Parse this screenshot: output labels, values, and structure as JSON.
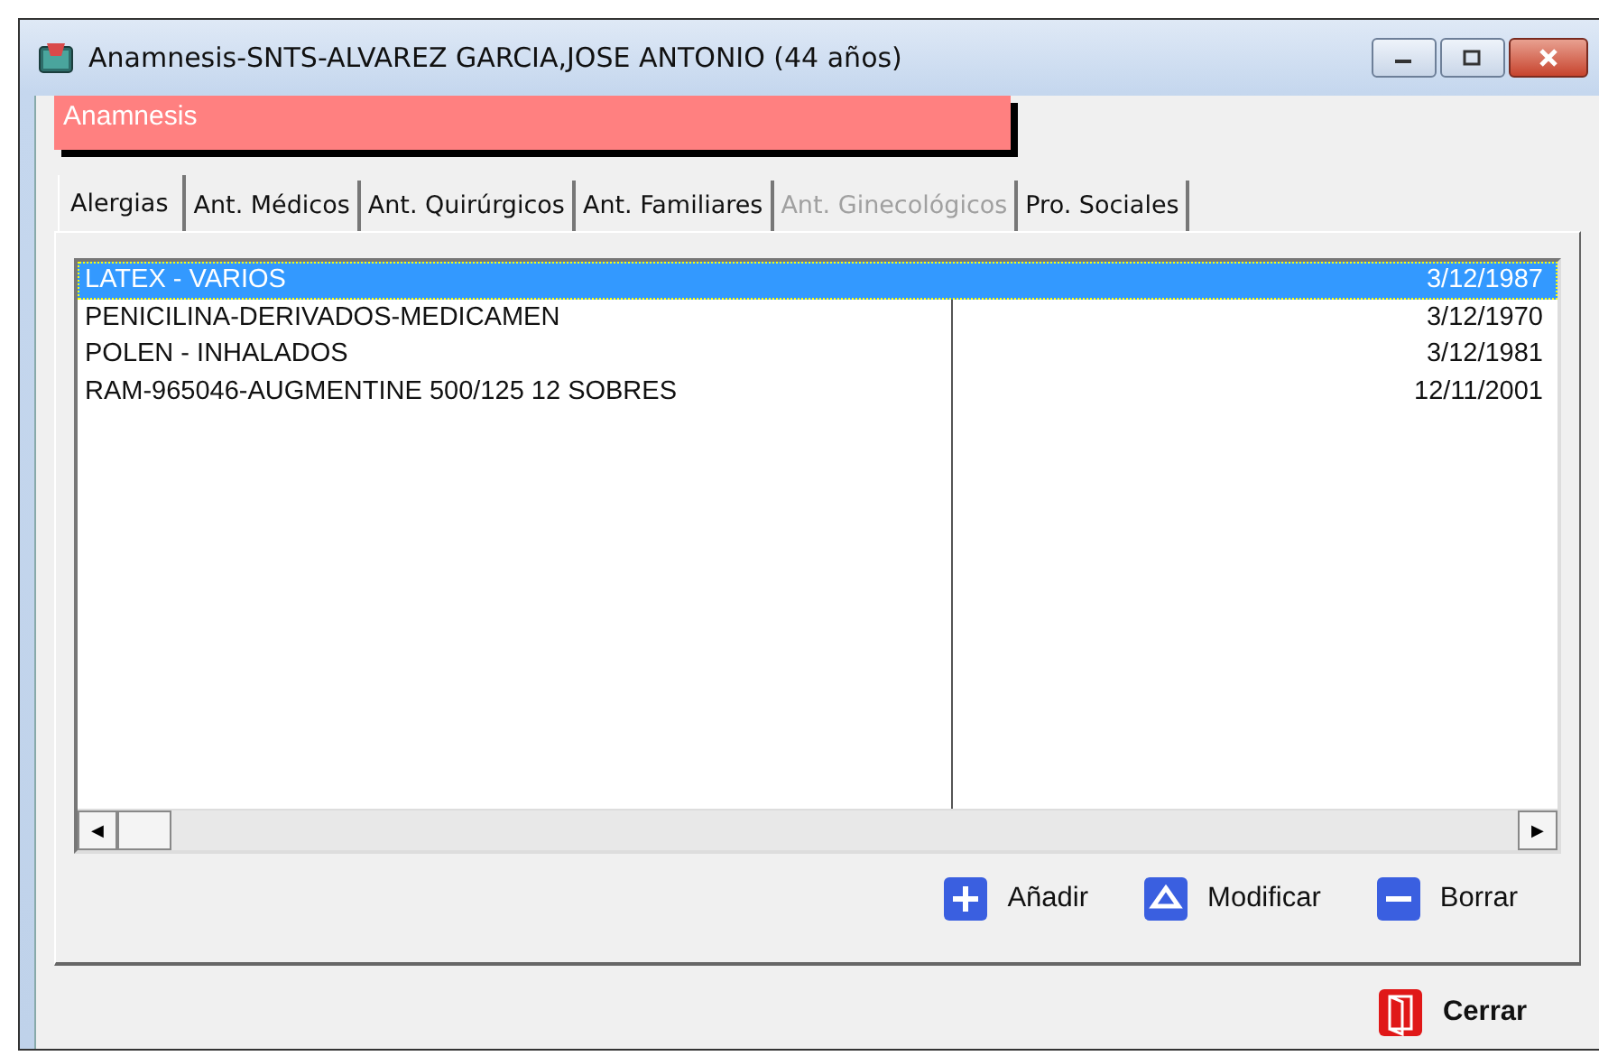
{
  "window": {
    "title": "Anamnesis-SNTS-ALVAREZ GARCIA,JOSE ANTONIO (44 años)"
  },
  "header": "Anamnesis",
  "tabs": [
    {
      "label": "Alergias",
      "selected": true,
      "disabled": false
    },
    {
      "label": "Ant. Médicos",
      "selected": false,
      "disabled": false
    },
    {
      "label": "Ant. Quirúrgicos",
      "selected": false,
      "disabled": false
    },
    {
      "label": "Ant. Familiares",
      "selected": false,
      "disabled": false
    },
    {
      "label": "Ant. Ginecológicos",
      "selected": false,
      "disabled": true
    },
    {
      "label": "Pro. Sociales",
      "selected": false,
      "disabled": false
    }
  ],
  "rows": [
    {
      "name": "LATEX - VARIOS",
      "date": "3/12/1987",
      "selected": true
    },
    {
      "name": "PENICILINA-DERIVADOS-MEDICAMEN",
      "date": "3/12/1970",
      "selected": false
    },
    {
      "name": "POLEN - INHALADOS",
      "date": "3/12/1981",
      "selected": false
    },
    {
      "name": "RAM-965046-AUGMENTINE 500/125 12 SOBRES",
      "date": "12/11/2001",
      "selected": false
    }
  ],
  "scroll_arrows": [
    "◀",
    "▶"
  ],
  "actions": [
    {
      "kind": "add",
      "label": "Añadir"
    },
    {
      "kind": "edit",
      "label": "Modificar"
    },
    {
      "kind": "delete",
      "label": "Borrar"
    }
  ],
  "close_button": "Cerrar"
}
